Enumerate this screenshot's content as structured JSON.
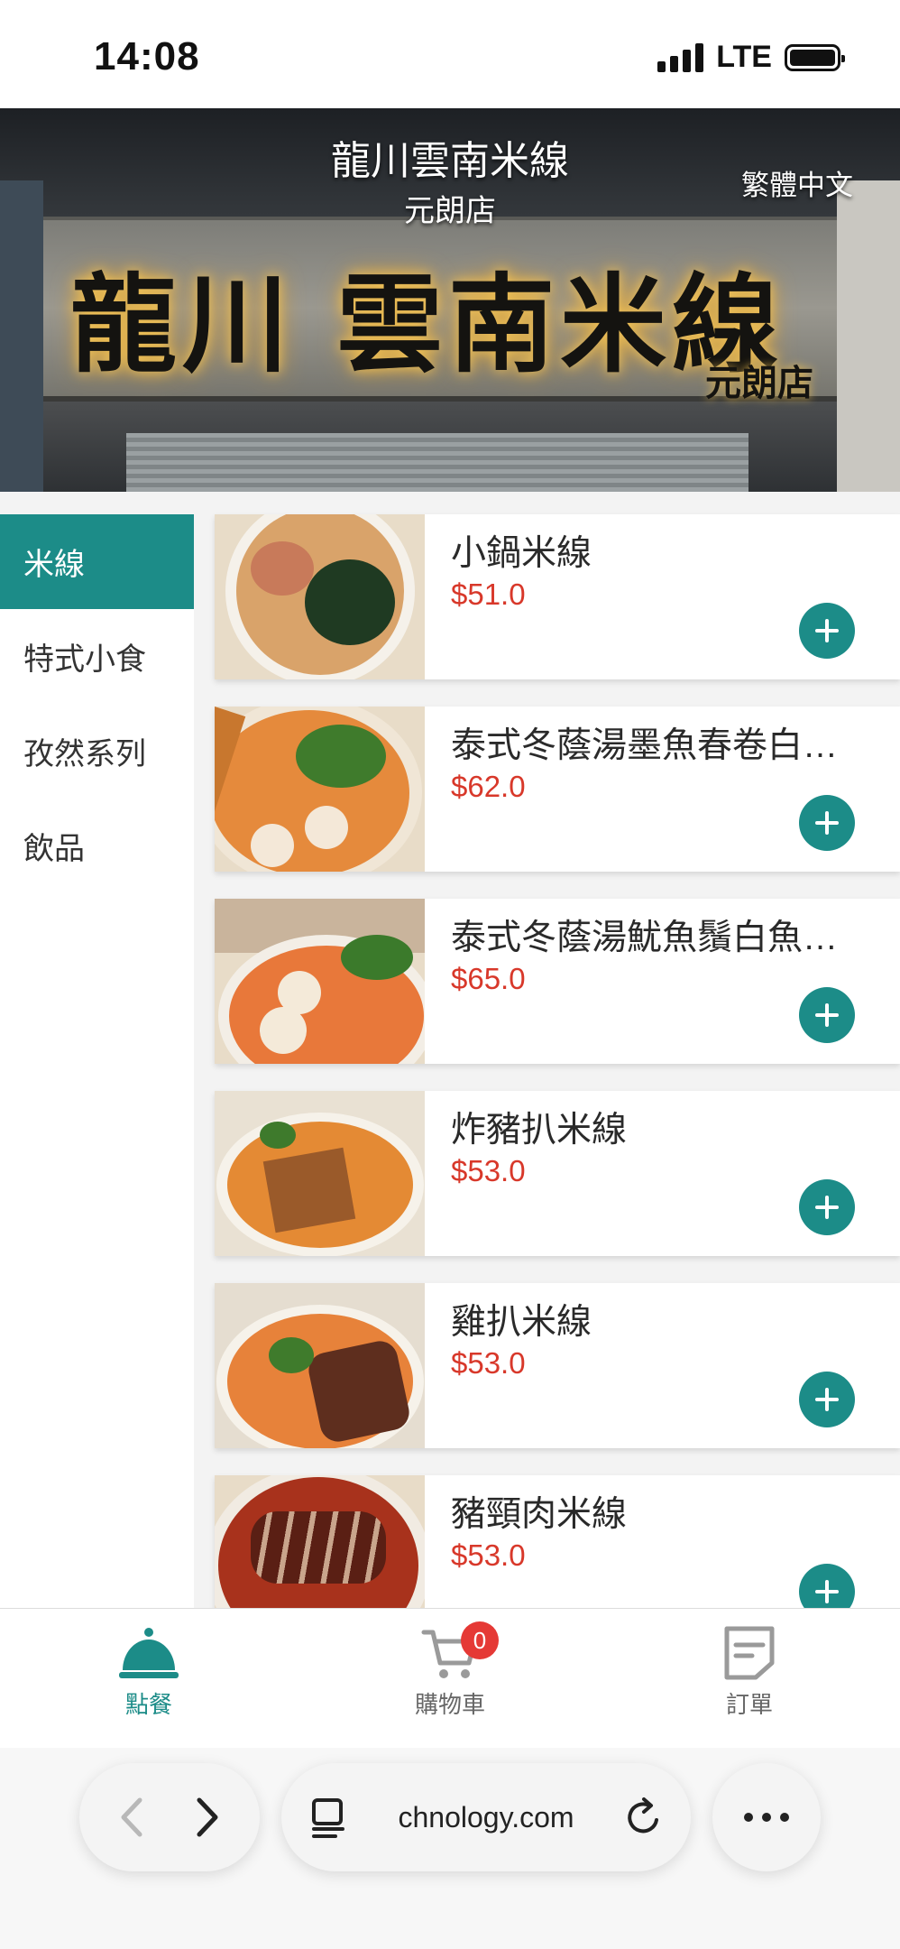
{
  "status_bar": {
    "time": "14:08",
    "network": "LTE"
  },
  "header": {
    "store_name": "龍川雲南米線",
    "branch": "元朗店",
    "language_toggle": "繁體中文",
    "sign_text": "龍川 雲南米線",
    "sign_branch": "元朗店"
  },
  "categories": [
    {
      "label": "米線",
      "active": true
    },
    {
      "label": "特式小食",
      "active": false
    },
    {
      "label": "孜然系列",
      "active": false
    },
    {
      "label": "飲品",
      "active": false
    }
  ],
  "products": [
    {
      "name": "小鍋米線",
      "price": "$51.0"
    },
    {
      "name": "泰式冬蔭湯墨魚春卷白…",
      "price": "$62.0"
    },
    {
      "name": "泰式冬蔭湯魷魚鬚白魚…",
      "price": "$65.0"
    },
    {
      "name": "炸豬扒米線",
      "price": "$53.0"
    },
    {
      "name": "雞扒米線",
      "price": "$53.0"
    },
    {
      "name": "豬頸肉米線",
      "price": "$53.0"
    }
  ],
  "bottom_nav": {
    "order": "點餐",
    "cart": "購物車",
    "cart_count": "0",
    "orders": "訂單"
  },
  "browser": {
    "url": "chnology.com"
  },
  "colors": {
    "accent": "#1c8c88",
    "price": "#d8382a",
    "badge": "#e53935"
  }
}
